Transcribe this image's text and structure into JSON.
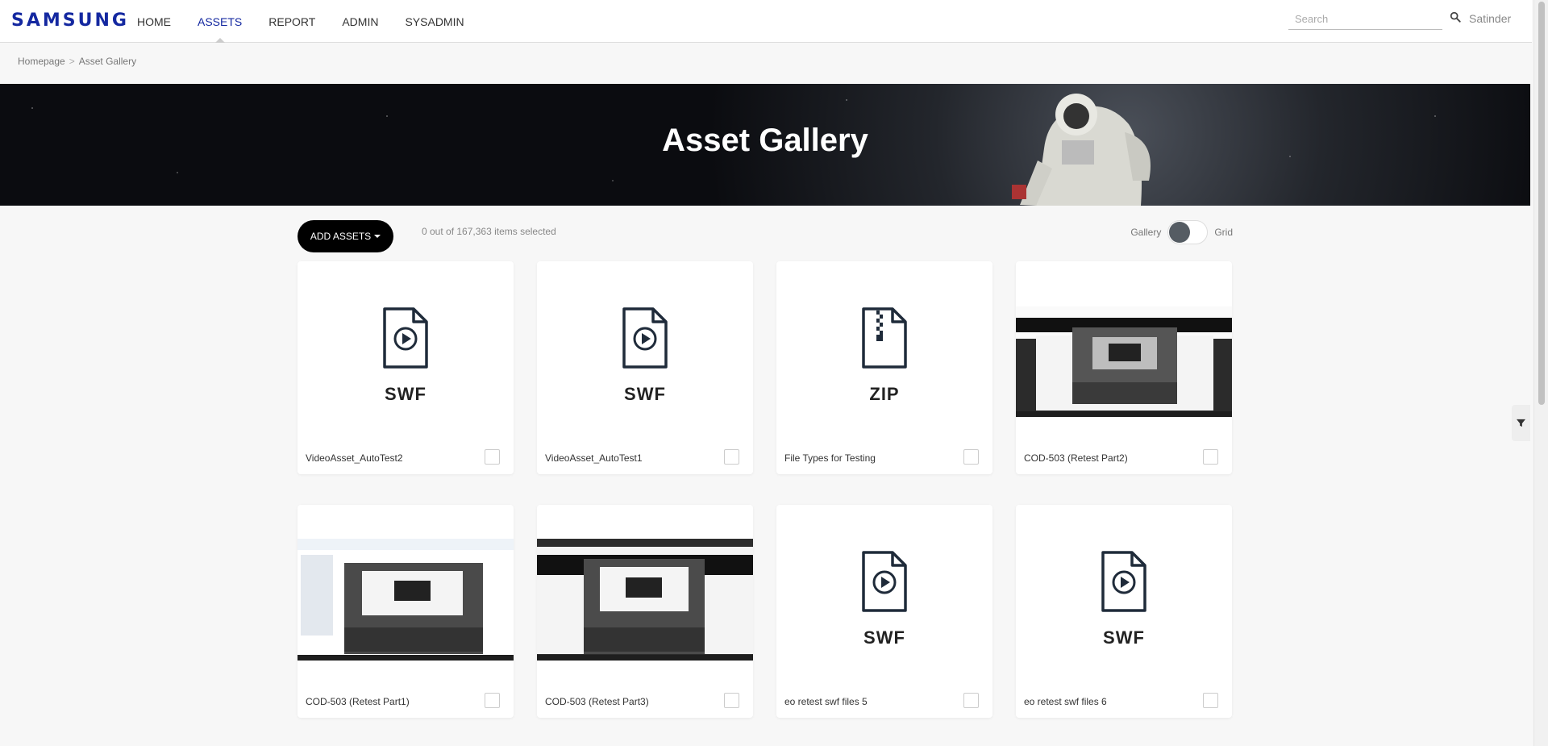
{
  "header": {
    "logo": "SAMSUNG",
    "nav": [
      {
        "label": "HOME",
        "active": false
      },
      {
        "label": "ASSETS",
        "active": true
      },
      {
        "label": "REPORT",
        "active": false
      },
      {
        "label": "ADMIN",
        "active": false
      },
      {
        "label": "SYSADMIN",
        "active": false
      }
    ],
    "search_placeholder": "Search",
    "user": "Satinder"
  },
  "breadcrumb": {
    "home": "Homepage",
    "separator": ">",
    "current": "Asset Gallery"
  },
  "banner": {
    "title": "Asset Gallery"
  },
  "toolbar": {
    "add_assets_label": "ADD ASSETS",
    "selection_text": "0 out of 167,363 items selected",
    "view_gallery_label": "Gallery",
    "view_grid_label": "Grid"
  },
  "assets": [
    {
      "name": "VideoAsset_AutoTest2",
      "type": "SWF",
      "icon": "video-file-icon"
    },
    {
      "name": "VideoAsset_AutoTest1",
      "type": "SWF",
      "icon": "video-file-icon"
    },
    {
      "name": "File Types for Testing",
      "type": "ZIP",
      "icon": "zip-file-icon"
    },
    {
      "name": "COD-503 (Retest Part2)",
      "type": "",
      "icon": "screenshot-thumbnail"
    },
    {
      "name": "COD-503 (Retest Part1)",
      "type": "",
      "icon": "screenshot-thumbnail"
    },
    {
      "name": "COD-503 (Retest Part3)",
      "type": "",
      "icon": "screenshot-thumbnail"
    },
    {
      "name": "eo retest swf files 5",
      "type": "SWF",
      "icon": "video-file-icon"
    },
    {
      "name": "eo retest swf files 6",
      "type": "SWF",
      "icon": "video-file-icon"
    }
  ],
  "colors": {
    "brand": "#1428a0",
    "button": "#000000",
    "toggle_knob": "#555c63"
  }
}
